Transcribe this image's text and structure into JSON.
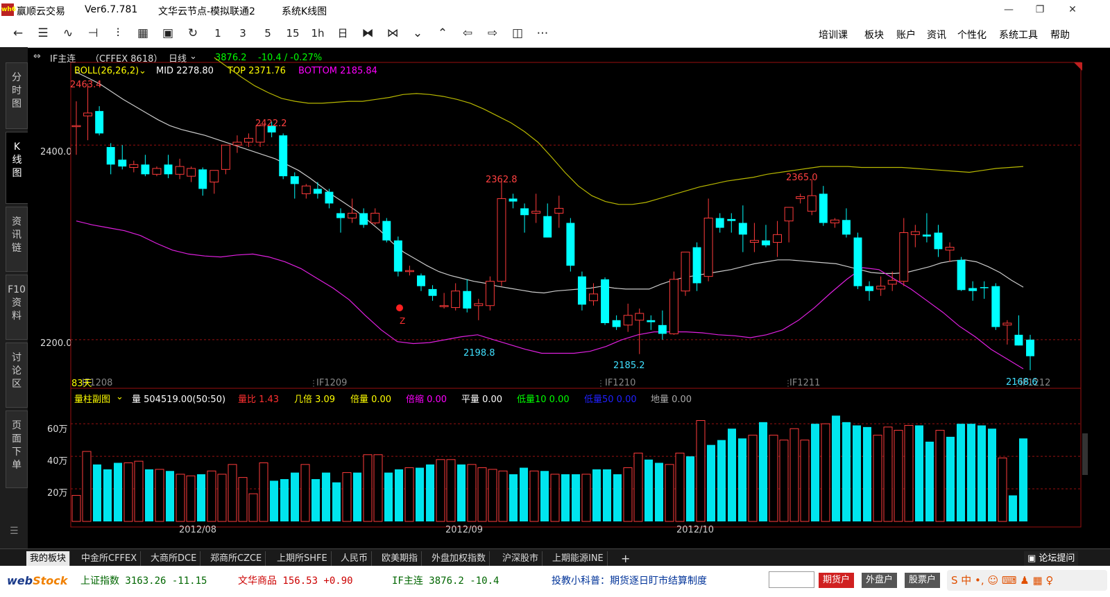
{
  "window": {
    "app_name": "赢顺云交易",
    "version": "Ver6.7.781",
    "node": "文华云节点-模拟联通2",
    "view": "系统K线图",
    "minimize": "—",
    "restore": "❐",
    "close": "✕"
  },
  "toolbar": {
    "icons": [
      "back-icon",
      "list-icon",
      "line-chart-icon",
      "candle-icon",
      "bar-icon",
      "grid-icon",
      "save-icon",
      "refresh-icon"
    ],
    "periods": [
      "1",
      "3",
      "5",
      "15",
      "1h",
      "日"
    ],
    "menu": [
      "培训课",
      "板块",
      "账户",
      "资讯",
      "个性化",
      "系统工具",
      "帮助"
    ]
  },
  "sidebar": {
    "tabs": [
      "分\n时\n图",
      "K\n线\n图",
      "资\n讯\n链",
      "F10\n资\n料",
      "讨\n论\n区",
      "页\n面\n下\n单"
    ]
  },
  "instrument": {
    "name": "IF主连",
    "code": "（CFFEX  8618）",
    "period": "日线",
    "price": "3876.2",
    "change": "-10.4 / -0.27%"
  },
  "indicator_main": {
    "name": "BOLL(26,26,2)",
    "mid": "MID 2278.80",
    "top": "TOP 2371.76",
    "bottom": "BOTTOM 2185.84"
  },
  "indicator_sub": {
    "name": "量柱副图",
    "vol": "量 504519.00(50:50)",
    "items": [
      {
        "text": "量比 1.43",
        "color": "#ff3030"
      },
      {
        "text": "几倍 3.09",
        "color": "#ffff00"
      },
      {
        "text": "倍量 0.00",
        "color": "#ffff00"
      },
      {
        "text": "倍缩 0.00",
        "color": "#ff00ff"
      },
      {
        "text": "平量 0.00",
        "color": "#ffffff"
      },
      {
        "text": "低量10 0.00",
        "color": "#00ff00"
      },
      {
        "text": "低量50 0.00",
        "color": "#2020ff"
      },
      {
        "text": "地量 0.00",
        "color": "#aaaaaa"
      }
    ]
  },
  "price_axis": {
    "labels": [
      "2400.0",
      "2200.0"
    ]
  },
  "volume_axis": {
    "labels": [
      "60万",
      "40万",
      "20万"
    ]
  },
  "date_axis": {
    "labels": [
      "2012/08",
      "2012/09",
      "2012/10"
    ]
  },
  "contracts": [
    "IF1208",
    "IF1209",
    "IF1210",
    "IF1211",
    "IF1212"
  ],
  "chart_labels": {
    "days": "83天",
    "peaks": [
      "2463.4",
      "2422.2",
      "2362.8",
      "2365.0"
    ],
    "troughs": [
      "2198.8",
      "2185.2",
      "2168.6"
    ],
    "signal": "Z"
  },
  "chart_data": {
    "type": "candlestick",
    "y_range": [
      2150,
      2485
    ],
    "candles": [
      {
        "o": 2420,
        "h": 2445,
        "l": 2390,
        "c": 2420
      },
      {
        "o": 2430,
        "h": 2463.4,
        "l": 2405,
        "c": 2433
      },
      {
        "o": 2435,
        "h": 2440,
        "l": 2410,
        "c": 2412
      },
      {
        "o": 2398,
        "h": 2402,
        "l": 2370,
        "c": 2380
      },
      {
        "o": 2385,
        "h": 2400,
        "l": 2375,
        "c": 2378
      },
      {
        "o": 2377,
        "h": 2384,
        "l": 2372,
        "c": 2380
      },
      {
        "o": 2380,
        "h": 2390,
        "l": 2368,
        "c": 2370
      },
      {
        "o": 2370,
        "h": 2378,
        "l": 2368,
        "c": 2376
      },
      {
        "o": 2380,
        "h": 2390,
        "l": 2366,
        "c": 2370
      },
      {
        "o": 2370,
        "h": 2386,
        "l": 2365,
        "c": 2378
      },
      {
        "o": 2368,
        "h": 2378,
        "l": 2362,
        "c": 2376
      },
      {
        "o": 2375,
        "h": 2377,
        "l": 2348,
        "c": 2355
      },
      {
        "o": 2362,
        "h": 2372,
        "l": 2350,
        "c": 2374
      },
      {
        "o": 2375,
        "h": 2400,
        "l": 2370,
        "c": 2400
      },
      {
        "o": 2400,
        "h": 2410,
        "l": 2392,
        "c": 2403
      },
      {
        "o": 2403,
        "h": 2412,
        "l": 2398,
        "c": 2407
      },
      {
        "o": 2403,
        "h": 2422.2,
        "l": 2398,
        "c": 2420
      },
      {
        "o": 2420,
        "h": 2424,
        "l": 2408,
        "c": 2413
      },
      {
        "o": 2410,
        "h": 2412,
        "l": 2365,
        "c": 2368
      },
      {
        "o": 2368,
        "h": 2372,
        "l": 2345,
        "c": 2360
      },
      {
        "o": 2350,
        "h": 2360,
        "l": 2345,
        "c": 2358
      },
      {
        "o": 2355,
        "h": 2362,
        "l": 2345,
        "c": 2350
      },
      {
        "o": 2352,
        "h": 2355,
        "l": 2335,
        "c": 2340
      },
      {
        "o": 2330,
        "h": 2335,
        "l": 2310,
        "c": 2325
      },
      {
        "o": 2325,
        "h": 2345,
        "l": 2320,
        "c": 2330
      },
      {
        "o": 2330,
        "h": 2335,
        "l": 2315,
        "c": 2318
      },
      {
        "o": 2320,
        "h": 2335,
        "l": 2318,
        "c": 2330
      },
      {
        "o": 2322,
        "h": 2325,
        "l": 2300,
        "c": 2302
      },
      {
        "o": 2302,
        "h": 2306,
        "l": 2265,
        "c": 2270
      },
      {
        "o": 2271,
        "h": 2276,
        "l": 2266,
        "c": 2271
      },
      {
        "o": 2266,
        "h": 2268,
        "l": 2250,
        "c": 2255
      },
      {
        "o": 2252,
        "h": 2256,
        "l": 2240,
        "c": 2245
      },
      {
        "o": 2235,
        "h": 2248,
        "l": 2232,
        "c": 2235
      },
      {
        "o": 2233,
        "h": 2258,
        "l": 2230,
        "c": 2250
      },
      {
        "o": 2250,
        "h": 2262,
        "l": 2228,
        "c": 2232
      },
      {
        "o": 2235,
        "h": 2242,
        "l": 2220,
        "c": 2237
      },
      {
        "o": 2235,
        "h": 2265,
        "l": 2230,
        "c": 2260
      },
      {
        "o": 2260,
        "h": 2362.8,
        "l": 2255,
        "c": 2345
      },
      {
        "o": 2345,
        "h": 2350,
        "l": 2335,
        "c": 2342
      },
      {
        "o": 2335,
        "h": 2340,
        "l": 2310,
        "c": 2328
      },
      {
        "o": 2330,
        "h": 2350,
        "l": 2320,
        "c": 2332
      },
      {
        "o": 2327,
        "h": 2340,
        "l": 2305,
        "c": 2305
      },
      {
        "o": 2330,
        "h": 2348,
        "l": 2315,
        "c": 2335
      },
      {
        "o": 2320,
        "h": 2325,
        "l": 2270,
        "c": 2276
      },
      {
        "o": 2265,
        "h": 2270,
        "l": 2230,
        "c": 2236
      },
      {
        "o": 2240,
        "h": 2258,
        "l": 2235,
        "c": 2247
      },
      {
        "o": 2262,
        "h": 2264,
        "l": 2215,
        "c": 2217
      },
      {
        "o": 2220,
        "h": 2225,
        "l": 2210,
        "c": 2213
      },
      {
        "o": 2215,
        "h": 2237,
        "l": 2208,
        "c": 2225
      },
      {
        "o": 2220,
        "h": 2232,
        "l": 2185.2,
        "c": 2227
      },
      {
        "o": 2220,
        "h": 2225,
        "l": 2210,
        "c": 2218
      },
      {
        "o": 2215,
        "h": 2230,
        "l": 2200,
        "c": 2206
      },
      {
        "o": 2206,
        "h": 2270,
        "l": 2205,
        "c": 2262
      },
      {
        "o": 2250,
        "h": 2290,
        "l": 2245,
        "c": 2290
      },
      {
        "o": 2295,
        "h": 2300,
        "l": 2250,
        "c": 2258
      },
      {
        "o": 2265,
        "h": 2345,
        "l": 2260,
        "c": 2325
      },
      {
        "o": 2325,
        "h": 2330,
        "l": 2310,
        "c": 2315
      },
      {
        "o": 2324,
        "h": 2330,
        "l": 2310,
        "c": 2322
      },
      {
        "o": 2320,
        "h": 2338,
        "l": 2290,
        "c": 2308
      },
      {
        "o": 2300,
        "h": 2320,
        "l": 2290,
        "c": 2302
      },
      {
        "o": 2302,
        "h": 2318,
        "l": 2295,
        "c": 2297
      },
      {
        "o": 2300,
        "h": 2322,
        "l": 2285,
        "c": 2308
      },
      {
        "o": 2322,
        "h": 2335,
        "l": 2300,
        "c": 2336
      },
      {
        "o": 2345,
        "h": 2350,
        "l": 2340,
        "c": 2347
      },
      {
        "o": 2332,
        "h": 2365.0,
        "l": 2328,
        "c": 2348
      },
      {
        "o": 2350,
        "h": 2358,
        "l": 2317,
        "c": 2320
      },
      {
        "o": 2320,
        "h": 2325,
        "l": 2315,
        "c": 2323
      },
      {
        "o": 2323,
        "h": 2335,
        "l": 2305,
        "c": 2308
      },
      {
        "o": 2305,
        "h": 2310,
        "l": 2252,
        "c": 2255
      },
      {
        "o": 2255,
        "h": 2260,
        "l": 2240,
        "c": 2250
      },
      {
        "o": 2252,
        "h": 2265,
        "l": 2245,
        "c": 2255
      },
      {
        "o": 2257,
        "h": 2270,
        "l": 2250,
        "c": 2261
      },
      {
        "o": 2260,
        "h": 2325,
        "l": 2255,
        "c": 2310
      },
      {
        "o": 2308,
        "h": 2318,
        "l": 2295,
        "c": 2311
      },
      {
        "o": 2308,
        "h": 2330,
        "l": 2300,
        "c": 2306
      },
      {
        "o": 2310,
        "h": 2318,
        "l": 2285,
        "c": 2293
      },
      {
        "o": 2292,
        "h": 2300,
        "l": 2280,
        "c": 2295
      },
      {
        "o": 2282,
        "h": 2285,
        "l": 2250,
        "c": 2251
      },
      {
        "o": 2253,
        "h": 2260,
        "l": 2240,
        "c": 2250
      },
      {
        "o": 2254,
        "h": 2260,
        "l": 2242,
        "c": 2253
      },
      {
        "o": 2255,
        "h": 2258,
        "l": 2210,
        "c": 2213
      },
      {
        "o": 2215,
        "h": 2220,
        "l": 2195,
        "c": 2217
      },
      {
        "o": 2205,
        "h": 2225,
        "l": 2194,
        "c": 2194
      },
      {
        "o": 2200,
        "h": 2205,
        "l": 2168.6,
        "c": 2183
      }
    ],
    "mid": [
      2475,
      2469,
      2463,
      2455,
      2447,
      2440,
      2433,
      2426,
      2420,
      2416,
      2413,
      2410,
      2406,
      2402,
      2398,
      2394,
      2390,
      2386,
      2380,
      2374,
      2366,
      2357,
      2348,
      2340,
      2332,
      2322,
      2312,
      2300,
      2290,
      2283,
      2276,
      2270,
      2266,
      2263,
      2260,
      2258,
      2255,
      2253,
      2251,
      2249,
      2248,
      2250,
      2251,
      2252,
      2253,
      2255,
      2253,
      2252,
      2252,
      2252,
      2257,
      2261,
      2264,
      2266,
      2268,
      2270,
      2272,
      2275,
      2278,
      2280,
      2282,
      2282,
      2281,
      2280,
      2279,
      2278,
      2275,
      2272,
      2269,
      2268,
      2268,
      2269,
      2272,
      2275,
      2279,
      2281,
      2282,
      2280,
      2275,
      2269,
      2261,
      2254
    ],
    "top": [
      2490,
      2480,
      2470,
      2461,
      2454,
      2448,
      2445,
      2443,
      2443,
      2444,
      2445,
      2445,
      2447,
      2449,
      2452,
      2453,
      2452,
      2450,
      2447,
      2443,
      2437,
      2430,
      2423,
      2414,
      2403,
      2388,
      2372,
      2358,
      2348,
      2342,
      2339,
      2339,
      2341,
      2345,
      2349,
      2353,
      2357,
      2360,
      2363,
      2365,
      2367,
      2370,
      2372,
      2374,
      2376,
      2378,
      2378,
      2378,
      2377,
      2377,
      2377,
      2377,
      2376,
      2375,
      2374,
      2373,
      2372,
      2374,
      2376,
      2377,
      2378
    ],
    "bottom": [
      2322,
      2318,
      2315,
      2312,
      2307,
      2299,
      2292,
      2288,
      2286,
      2285,
      2287,
      2288,
      2285,
      2280,
      2273,
      2263,
      2253,
      2241,
      2225,
      2210,
      2198,
      2196,
      2197,
      2200,
      2203,
      2205,
      2200,
      2195,
      2190,
      2186,
      2186,
      2186,
      2188,
      2193,
      2200,
      2205,
      2208,
      2208,
      2208,
      2207,
      2205,
      2204,
      2202,
      2205,
      2210,
      2220,
      2233,
      2248,
      2262,
      2274,
      2272,
      2262,
      2252,
      2240,
      2228,
      2214,
      2203,
      2190,
      2180,
      2170
    ],
    "volume_max": 72,
    "volumes": [
      16,
      43,
      35,
      32,
      36,
      36,
      37,
      32,
      32,
      31,
      29,
      28,
      29,
      31,
      29,
      35,
      27,
      17,
      36,
      25,
      26,
      30,
      35,
      26,
      30,
      24,
      30,
      30,
      41,
      41,
      30,
      32,
      33,
      33,
      35,
      38,
      38,
      35,
      35,
      33,
      32,
      31,
      29,
      33,
      31,
      31,
      29,
      29,
      29,
      29,
      32,
      32,
      29,
      33,
      42,
      38,
      36,
      35,
      42,
      40,
      62,
      47,
      50,
      57,
      51,
      53,
      61,
      53,
      50,
      57,
      50,
      60,
      60,
      65,
      61,
      59,
      58,
      53,
      58,
      56,
      59,
      59,
      49,
      56,
      52,
      60,
      60,
      59,
      57,
      39,
      16,
      51
    ]
  }
}
